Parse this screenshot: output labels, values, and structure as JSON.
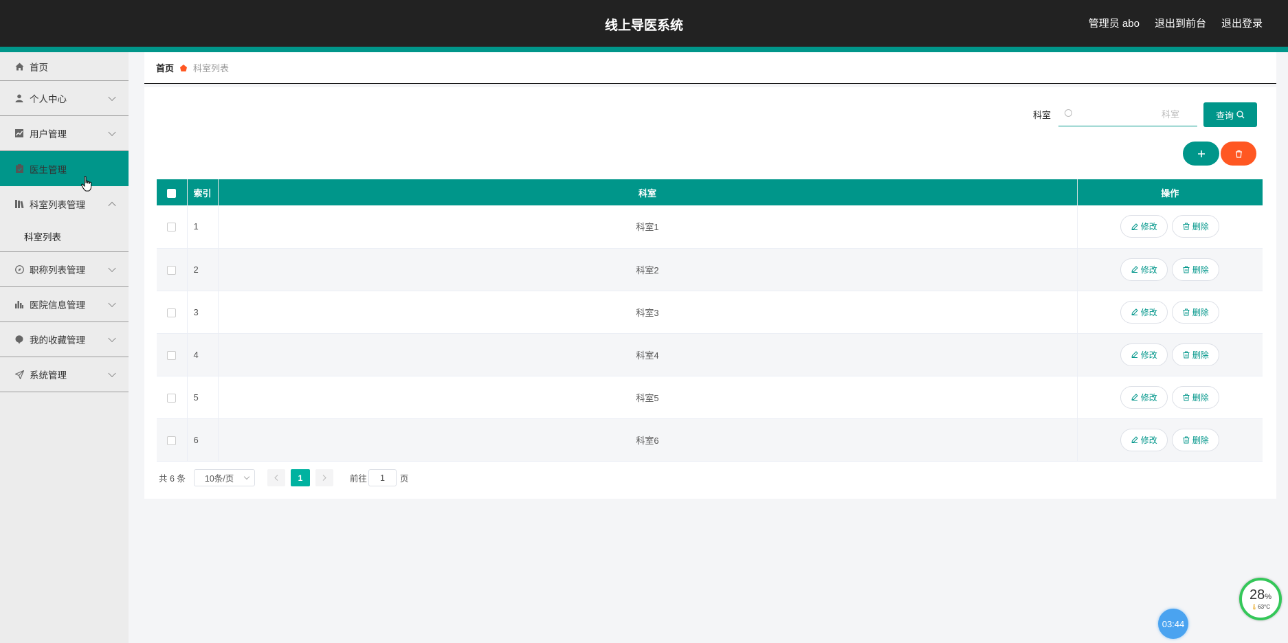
{
  "header": {
    "title": "线上导医系统",
    "admin_label": "管理员 abo",
    "front_link": "退出到前台",
    "logout_link": "退出登录"
  },
  "sidebar": {
    "items": [
      {
        "label": "首页",
        "icon": "home-icon"
      },
      {
        "label": "个人中心",
        "icon": "user-icon"
      },
      {
        "label": "用户管理",
        "icon": "chart-icon"
      },
      {
        "label": "医生管理",
        "icon": "clipboard-icon"
      },
      {
        "label": "科室列表管理",
        "icon": "books-icon"
      },
      {
        "label": "职称列表管理",
        "icon": "compass-icon"
      },
      {
        "label": "医院信息管理",
        "icon": "bar-chart-icon"
      },
      {
        "label": "我的收藏管理",
        "icon": "balloon-icon"
      },
      {
        "label": "系统管理",
        "icon": "send-icon"
      }
    ],
    "submenu_label": "科室列表"
  },
  "breadcrumb": {
    "home": "首页",
    "current": "科室列表"
  },
  "search": {
    "label": "科室",
    "placeholder": "科室",
    "button": "查询"
  },
  "table": {
    "headers": {
      "index": "索引",
      "name": "科室",
      "ops": "操作"
    },
    "rows": [
      {
        "index": "1",
        "name": "科室1"
      },
      {
        "index": "2",
        "name": "科室2"
      },
      {
        "index": "3",
        "name": "科室3"
      },
      {
        "index": "4",
        "name": "科室4"
      },
      {
        "index": "5",
        "name": "科室5"
      },
      {
        "index": "6",
        "name": "科室6"
      }
    ],
    "edit_label": "修改",
    "delete_label": "删除"
  },
  "pager": {
    "total": "共 6 条",
    "page_size": "10条/页",
    "current_page": "1",
    "goto_label": "前往",
    "goto_value": "1",
    "page_suffix": "页"
  },
  "widgets": {
    "gauge_percent": "28",
    "gauge_unit": "%",
    "temperature": "63°C",
    "clock": "03:44"
  },
  "colors": {
    "accent": "#00968a",
    "danger": "#ff5722",
    "header_bg": "#222222"
  }
}
